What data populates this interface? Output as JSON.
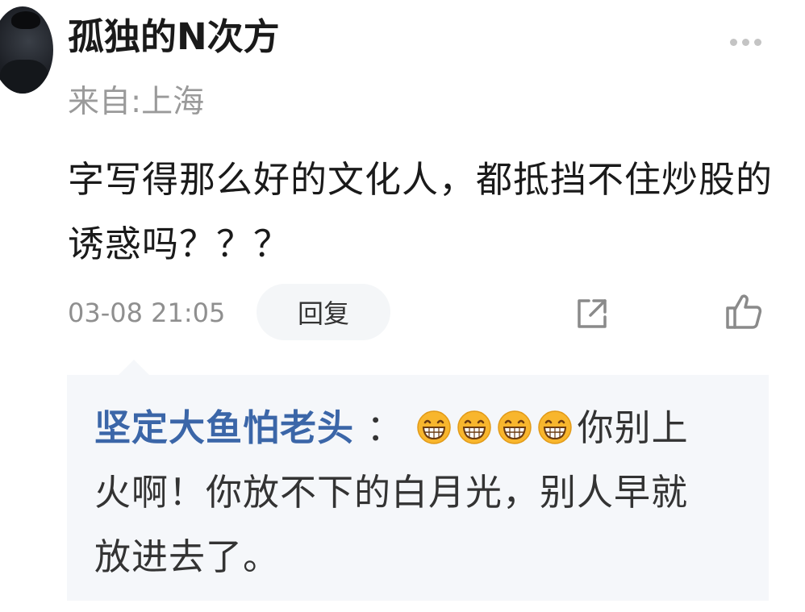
{
  "comment": {
    "username": "孤独的N次方",
    "location": "来自:上海",
    "text": "字写得那么好的文化人，都抵挡不住炒股的诱惑吗？？？",
    "timestamp": "03-08 21:05",
    "reply_label": "回复"
  },
  "icons": {
    "avatar": "avatar-photo",
    "more": "more-dots-icon",
    "share": "share-icon",
    "like": "thumbs-up-icon",
    "emoji": "grinning-face-emoji"
  },
  "reply": {
    "author": "坚定大鱼怕老头",
    "separator": " ：",
    "emoji_count": 4,
    "text": "你别上火啊！你放不下的白月光，别人早就放进去了。"
  },
  "colors": {
    "author_link": "#3b66a8",
    "secondary_text": "#9a9a9a",
    "reply_background": "#f5f7fa",
    "button_background": "#f4f6f8",
    "emoji_face": "#f8b62d"
  }
}
